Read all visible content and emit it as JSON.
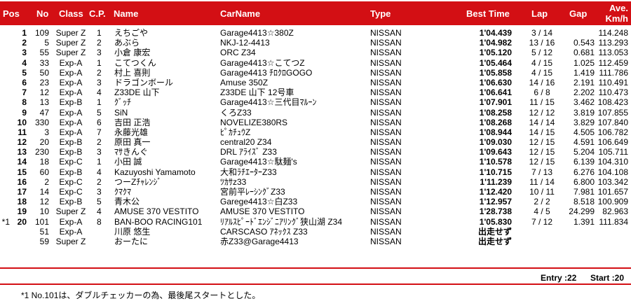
{
  "headers": {
    "pos": "Pos",
    "no": "No",
    "class": "Class",
    "cp": "C.P.",
    "name": "Name",
    "car": "CarName",
    "type": "Type",
    "best": "Best Time",
    "lap": "Lap",
    "gap": "Gap",
    "ave1": "Ave.",
    "ave2": "Km/h"
  },
  "rows": [
    {
      "mark": "",
      "pos": "1",
      "no": "109",
      "cls": "Super Z",
      "cp": "1",
      "name": "えちごや",
      "car": "Garage4413☆380Z",
      "type": "NISSAN",
      "best": "1'04.439",
      "lap": "3 / 14",
      "gap": "",
      "ave": "114.248"
    },
    {
      "mark": "",
      "pos": "2",
      "no": "5",
      "cls": "Super Z",
      "cp": "2",
      "name": "あぶら",
      "car": "NKJ-12-4413",
      "type": "NISSAN",
      "best": "1'04.982",
      "lap": "13 / 16",
      "gap": "0.543",
      "ave": "113.293"
    },
    {
      "mark": "",
      "pos": "3",
      "no": "55",
      "cls": "Super Z",
      "cp": "3",
      "name": "小倉 康宏",
      "car": "ORC Z34",
      "type": "NISSAN",
      "best": "1'05.120",
      "lap": "5 / 12",
      "gap": "0.681",
      "ave": "113.053"
    },
    {
      "mark": "",
      "pos": "4",
      "no": "33",
      "cls": "Exp-A",
      "cp": "1",
      "name": "こてつくん",
      "car": "Garage4413☆こてつZ",
      "type": "NISSAN",
      "best": "1'05.464",
      "lap": "4 / 15",
      "gap": "1.025",
      "ave": "112.459"
    },
    {
      "mark": "",
      "pos": "5",
      "no": "50",
      "cls": "Exp-A",
      "cp": "2",
      "name": "村上 喜則",
      "car": "Garage4413 ﾁﾛｸﾛGOGO",
      "type": "NISSAN",
      "best": "1'05.858",
      "lap": "4 / 15",
      "gap": "1.419",
      "ave": "111.786"
    },
    {
      "mark": "",
      "pos": "6",
      "no": "23",
      "cls": "Exp-A",
      "cp": "3",
      "name": "ドラゴンボール",
      "car": "Amuse 350Z",
      "type": "NISSAN",
      "best": "1'06.630",
      "lap": "14 / 16",
      "gap": "2.191",
      "ave": "110.491"
    },
    {
      "mark": "",
      "pos": "7",
      "no": "12",
      "cls": "Exp-A",
      "cp": "4",
      "name": "Z33DE 山下",
      "car": "Z33DE 山下 12号車",
      "type": "NISSAN",
      "best": "1'06.641",
      "lap": "6 / 8",
      "gap": "2.202",
      "ave": "110.473"
    },
    {
      "mark": "",
      "pos": "8",
      "no": "13",
      "cls": "Exp-B",
      "cp": "1",
      "name": "ｸﾞｯﾁ",
      "car": "Garage4413☆三代目ﾏﾙｰﾝ",
      "type": "NISSAN",
      "best": "1'07.901",
      "lap": "11 / 15",
      "gap": "3.462",
      "ave": "108.423"
    },
    {
      "mark": "",
      "pos": "9",
      "no": "47",
      "cls": "Exp-A",
      "cp": "5",
      "name": "SiN",
      "car": "くろZ33",
      "type": "NISSAN",
      "best": "1'08.258",
      "lap": "12 / 12",
      "gap": "3.819",
      "ave": "107.855"
    },
    {
      "mark": "",
      "pos": "10",
      "no": "330",
      "cls": "Exp-A",
      "cp": "6",
      "name": "吉田 正浩",
      "car": "NOVELIZE380RS",
      "type": "NISSAN",
      "best": "1'08.268",
      "lap": "14 / 14",
      "gap": "3.829",
      "ave": "107.840"
    },
    {
      "mark": "",
      "pos": "11",
      "no": "3",
      "cls": "Exp-A",
      "cp": "7",
      "name": "永藤光雄",
      "car": "ﾋﾟｶﾁｭｳZ",
      "type": "NISSAN",
      "best": "1'08.944",
      "lap": "14 / 15",
      "gap": "4.505",
      "ave": "106.782"
    },
    {
      "mark": "",
      "pos": "12",
      "no": "20",
      "cls": "Exp-B",
      "cp": "2",
      "name": "原田 真一",
      "car": "central20 Z34",
      "type": "NISSAN",
      "best": "1'09.030",
      "lap": "12 / 15",
      "gap": "4.591",
      "ave": "106.649"
    },
    {
      "mark": "",
      "pos": "13",
      "no": "230",
      "cls": "Exp-B",
      "cp": "3",
      "name": "ﾏｻきんぐ",
      "car": "DRL ｱﾗｲｽﾞ Z33",
      "type": "NISSAN",
      "best": "1'09.643",
      "lap": "12 / 15",
      "gap": "5.204",
      "ave": "105.711"
    },
    {
      "mark": "",
      "pos": "14",
      "no": "18",
      "cls": "Exp-C",
      "cp": "1",
      "name": "小田 誠",
      "car": "Garage4413☆駄麺's",
      "type": "NISSAN",
      "best": "1'10.578",
      "lap": "12 / 15",
      "gap": "6.139",
      "ave": "104.310"
    },
    {
      "mark": "",
      "pos": "15",
      "no": "60",
      "cls": "Exp-B",
      "cp": "4",
      "name": "Kazuyoshi Yamamoto",
      "car": "大和ﾗﾁｴｰﾀｰZ33",
      "type": "NISSAN",
      "best": "1'10.715",
      "lap": "7 / 13",
      "gap": "6.276",
      "ave": "104.108"
    },
    {
      "mark": "",
      "pos": "16",
      "no": "2",
      "cls": "Exp-C",
      "cp": "2",
      "name": "つーZﾁｬﾚﾝｼﾞ",
      "car": "ﾂｶｻz33",
      "type": "NISSAN",
      "best": "1'11.239",
      "lap": "11 / 14",
      "gap": "6.800",
      "ave": "103.342"
    },
    {
      "mark": "",
      "pos": "17",
      "no": "14",
      "cls": "Exp-C",
      "cp": "3",
      "name": "ｸﾏｸﾏ",
      "car": "宮前平ﾚｰｼﾝｸﾞZ33",
      "type": "NISSAN",
      "best": "1'12.420",
      "lap": "10 / 11",
      "gap": "7.981",
      "ave": "101.657"
    },
    {
      "mark": "",
      "pos": "18",
      "no": "12",
      "cls": "Exp-B",
      "cp": "5",
      "name": "青木公",
      "car": "Garege4413☆白Z33",
      "type": "NISSAN",
      "best": "1'12.957",
      "lap": "2 / 2",
      "gap": "8.518",
      "ave": "100.909"
    },
    {
      "mark": "",
      "pos": "19",
      "no": "10",
      "cls": "Super Z",
      "cp": "4",
      "name": "AMUSE 370 VESTITO",
      "car": "AMUSE 370 VESTITO",
      "type": "NISSAN",
      "best": "1'28.738",
      "lap": "4 / 5",
      "gap": "24.299",
      "ave": "82.963"
    },
    {
      "mark": "*1",
      "pos": "20",
      "no": "101",
      "cls": "Exp-A",
      "cp": "8",
      "name": "BAN-BOO RACING101",
      "car": "ﾘｱﾙｽﾋﾟｰﾄﾞｴﾝｼﾞﾆｱﾘﾝｸﾞ狭山湖 Z34",
      "type": "NISSAN",
      "best": "1'05.830",
      "lap": "7 / 12",
      "gap": "1.391",
      "ave": "111.834"
    },
    {
      "mark": "",
      "pos": "",
      "no": "51",
      "cls": "Exp-A",
      "cp": "",
      "name": "川原 悠生",
      "car": "CARSCASO ｱﾈｯｸｽ Z33",
      "type": "NISSAN",
      "best": "出走せず",
      "lap": "",
      "gap": "",
      "ave": ""
    },
    {
      "mark": "",
      "pos": "",
      "no": "59",
      "cls": "Super Z",
      "cp": "",
      "name": "おーたに",
      "car": "赤Z33@Garage4413",
      "type": "NISSAN",
      "best": "出走せず",
      "lap": "",
      "gap": "",
      "ave": ""
    }
  ],
  "summary": {
    "entry": "Entry :22",
    "start": "Start :20"
  },
  "footnote": "*1 No.101は、ダブルチェッカーの為、最後尾スタートとした。",
  "colors": {
    "header_bg": "#d30f14",
    "header_text": "#ffffff"
  }
}
